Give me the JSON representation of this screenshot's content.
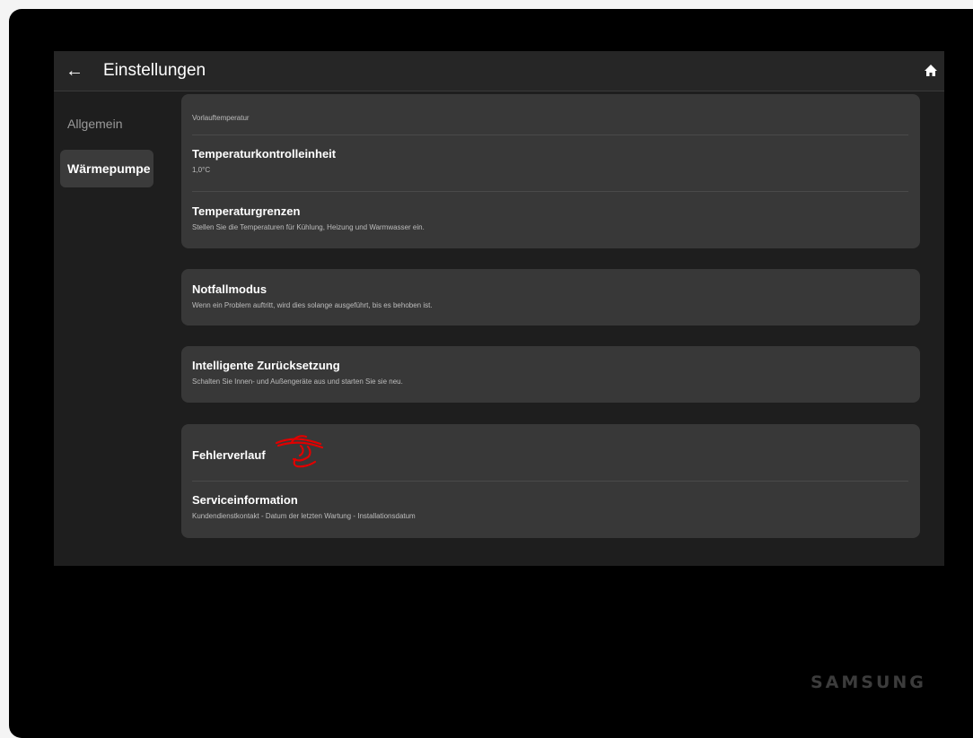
{
  "header": {
    "title": "Einstellungen",
    "back_icon": "arrow-left-icon",
    "home_icon": "home-icon"
  },
  "sidebar": {
    "items": [
      {
        "label": "Allgemein",
        "active": false
      },
      {
        "label": "Wärmepumpe",
        "active": true
      }
    ]
  },
  "settings": {
    "group1": {
      "vorlauf_sub": "Vorlauftemperatur",
      "tk_title": "Temperaturkontrolleinheit",
      "tk_sub": "1,0°C",
      "tg_title": "Temperaturgrenzen",
      "tg_sub": "Stellen Sie die Temperaturen für Kühlung, Heizung und Warmwasser ein."
    },
    "notfall": {
      "title": "Notfallmodus",
      "sub": "Wenn ein Problem auftritt, wird dies solange ausgeführt, bis es behoben ist."
    },
    "reset": {
      "title": "Intelligente Zurücksetzung",
      "sub": "Schalten Sie Innen- und Außengeräte aus und starten Sie sie neu."
    },
    "group4": {
      "fehler_title": "Fehlerverlauf",
      "service_title": "Serviceinformation",
      "service_sub": "Kundendienstkontakt - Datum der letzten Wartung - Installationsdatum"
    }
  },
  "brand": "SAMSUNG",
  "colors": {
    "screen_bg": "#1e1e1e",
    "card_bg": "#383838",
    "annotation": "#e00000"
  }
}
